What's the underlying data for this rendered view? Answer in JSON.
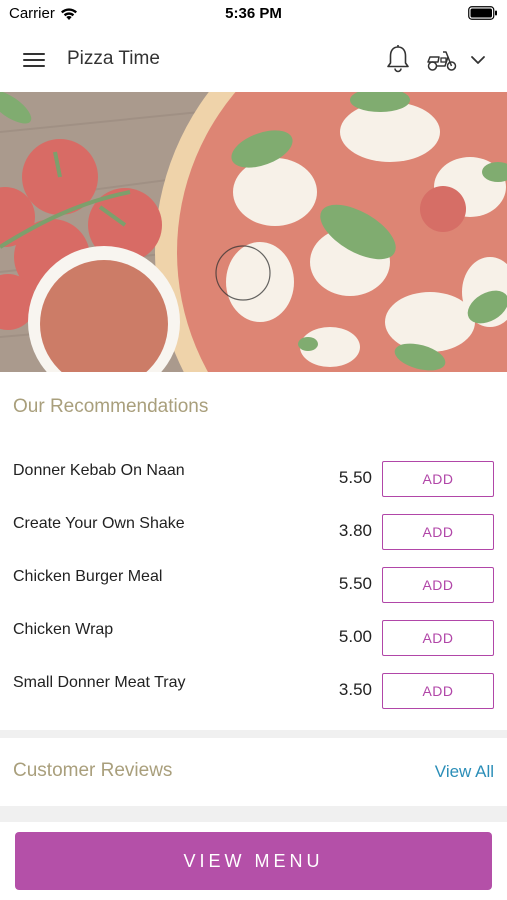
{
  "status_bar": {
    "carrier": "Carrier",
    "time": "5:36 PM",
    "icons": [
      "wifi-icon",
      "battery-icon"
    ]
  },
  "header": {
    "title": "Pizza Time",
    "icons": [
      "hamburger-menu-icon",
      "bell-icon",
      "delivery-scooter-icon",
      "chevron-down-icon"
    ]
  },
  "hero": {
    "image_description_icon": "pizza-hero-image"
  },
  "recommendations": {
    "title": "Our Recommendations",
    "items": [
      {
        "name": "Donner Kebab On Naan",
        "price": "5.50",
        "button": "ADD"
      },
      {
        "name": "Create Your Own Shake",
        "price": "3.80",
        "button": "ADD"
      },
      {
        "name": "Chicken Burger Meal",
        "price": "5.50",
        "button": "ADD"
      },
      {
        "name": "Chicken Wrap",
        "price": "5.00",
        "button": "ADD"
      },
      {
        "name": "Small Donner Meat Tray",
        "price": "3.50",
        "button": "ADD"
      }
    ]
  },
  "reviews": {
    "title": "Customer Reviews",
    "view_all": "View All"
  },
  "footer": {
    "view_menu_label": "VIEW MENU"
  },
  "colors": {
    "accent_purple": "#b146a8",
    "section_title": "#a99f7c",
    "link_blue": "#2b8eb8"
  }
}
